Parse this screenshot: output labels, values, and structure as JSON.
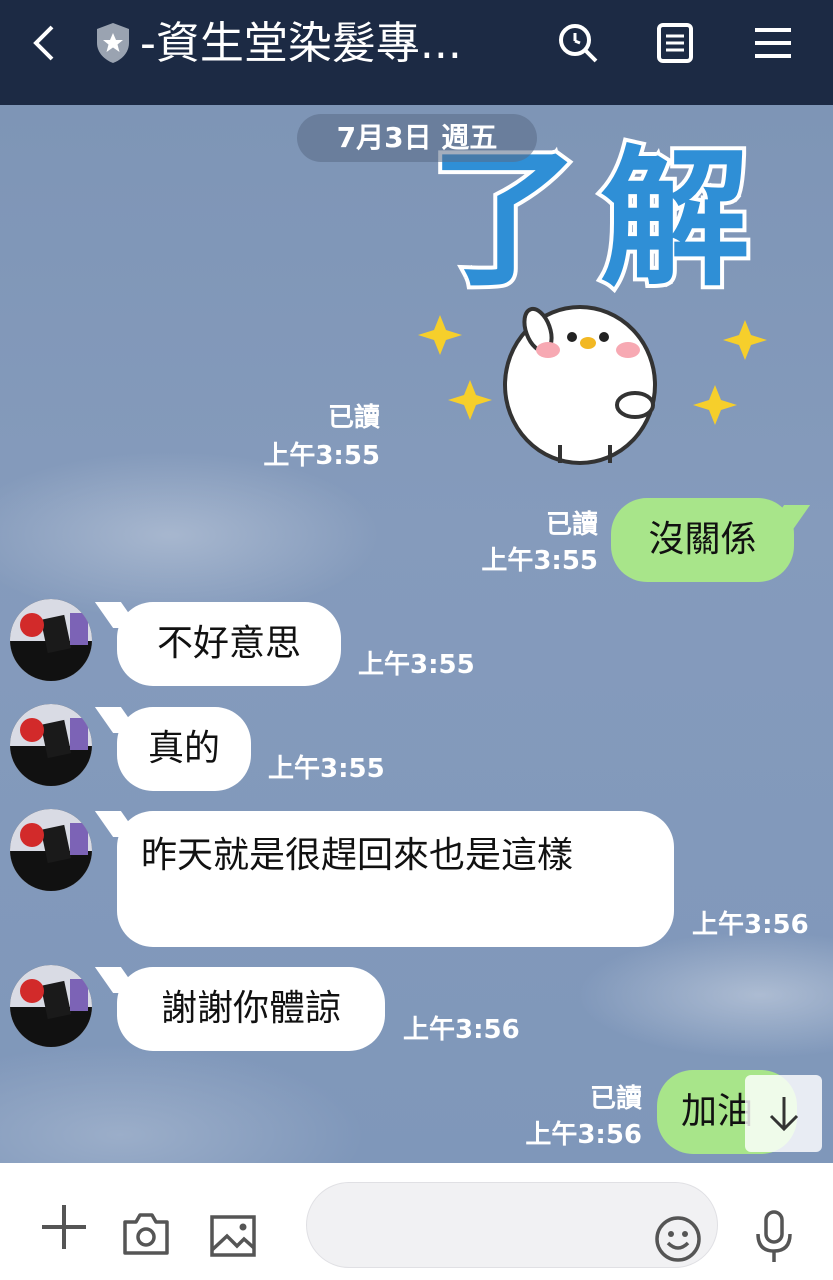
{
  "header": {
    "title": "-資生堂染髮專...",
    "icons": [
      "back-arrow-icon",
      "shield-star-icon",
      "search-icon",
      "notes-icon",
      "menu-icon"
    ]
  },
  "chat": {
    "date": "7月3日 週五",
    "sticker": {
      "text": "了解",
      "icon": "chick-sticker",
      "read": "已讀",
      "time": "上午3:55"
    },
    "messages": [
      {
        "side": "out",
        "text": "沒關係",
        "read": "已讀",
        "time": "上午3:55"
      },
      {
        "side": "in",
        "text": "不好意思",
        "time": "上午3:55"
      },
      {
        "side": "in",
        "text": "真的",
        "time": "上午3:55"
      },
      {
        "side": "in",
        "text": "昨天就是很趕回來也是這樣",
        "time": "上午3:56"
      },
      {
        "side": "in",
        "text": "謝謝你體諒",
        "time": "上午3:56"
      },
      {
        "side": "out",
        "text": "加油",
        "read": "已讀",
        "time": "上午3:56"
      }
    ]
  },
  "bottom": {
    "input_placeholder": "",
    "icons": [
      "plus-icon",
      "camera-icon",
      "image-icon",
      "emoji-icon",
      "microphone-icon"
    ]
  },
  "colors": {
    "header": "#1c2a44",
    "out_bubble": "#a8e58a",
    "sticker_text": "#2f8fd6"
  }
}
